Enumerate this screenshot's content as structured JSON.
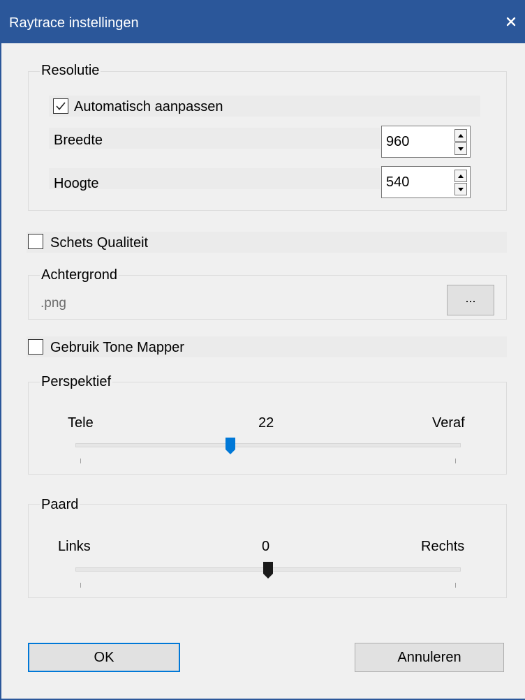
{
  "window": {
    "title": "Raytrace instellingen"
  },
  "resolutie": {
    "group_label": "Resolutie",
    "auto_adjust_label": "Automatisch aanpassen",
    "auto_adjust_checked": true,
    "width_label": "Breedte",
    "width_value": "960",
    "height_label": "Hoogte",
    "height_value": "540"
  },
  "sketch_quality": {
    "label": "Schets Qualiteit",
    "checked": false
  },
  "background": {
    "group_label": "Achtergrond",
    "file_value": ".png",
    "browse_label": "..."
  },
  "tone_mapper": {
    "label": "Gebruik Tone Mapper",
    "checked": false
  },
  "perspective": {
    "group_label": "Perspektief",
    "min_label": "Tele",
    "value": "22",
    "max_label": "Veraf",
    "slider_fraction": 0.4
  },
  "horse": {
    "group_label": "Paard",
    "min_label": "Links",
    "value": "0",
    "max_label": "Rechts",
    "slider_fraction": 0.5
  },
  "buttons": {
    "ok_label": "OK",
    "cancel_label": "Annuleren"
  },
  "colors": {
    "titlebar": "#2b579a",
    "accent": "#0078d7",
    "thumb_dark": "#1a1a1a"
  }
}
